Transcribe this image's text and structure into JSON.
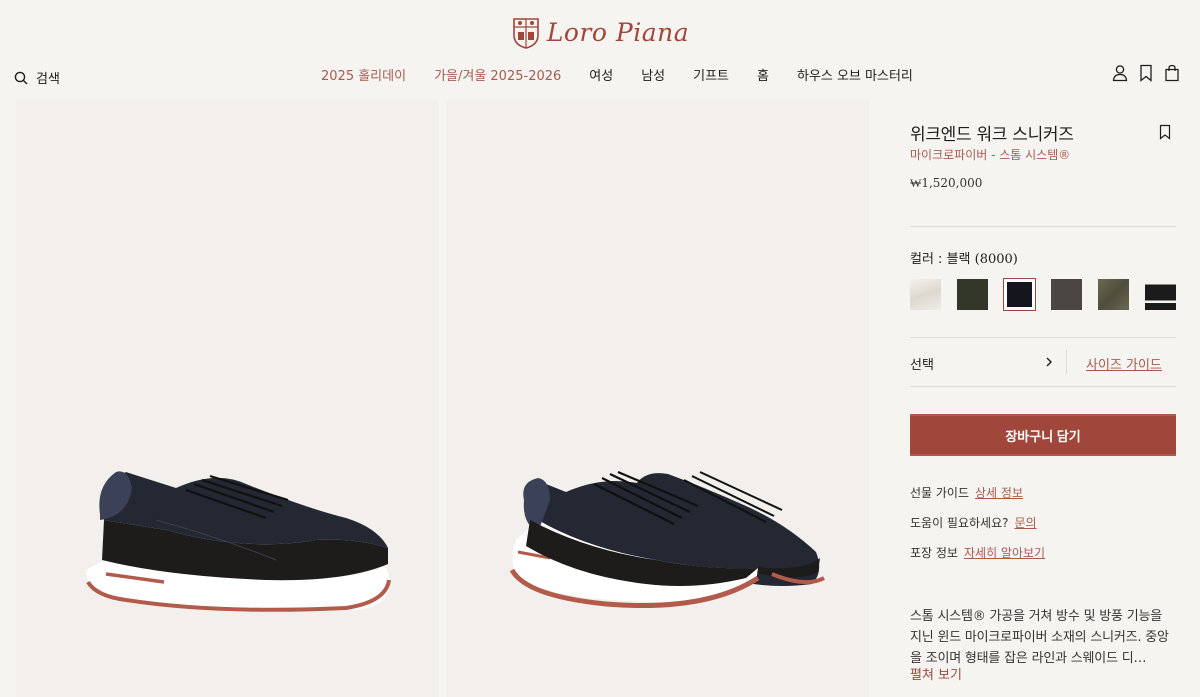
{
  "brand": {
    "name": "Loro Piana"
  },
  "header": {
    "search_label": "검색",
    "nav": [
      {
        "label": "2025 홀리데이",
        "accent": true
      },
      {
        "label": "가을/겨울 2025-2026",
        "accent": true
      },
      {
        "label": "여성",
        "accent": false
      },
      {
        "label": "남성",
        "accent": false
      },
      {
        "label": "기프트",
        "accent": false
      },
      {
        "label": "홈",
        "accent": false
      },
      {
        "label": "하우스 오브 마스터리",
        "accent": false
      }
    ]
  },
  "product": {
    "title": "위크엔드 워크 스니커즈",
    "subtitle": "마이크로파이버 - 스톰 시스템®",
    "price": "₩1,520,000",
    "color_label": "컬러 : 블랙",
    "color_code": "(8000)",
    "swatches": [
      {
        "name": "white",
        "color": "#ebe8e1",
        "selected": false
      },
      {
        "name": "dark-green",
        "color": "#32372a",
        "selected": false
      },
      {
        "name": "black",
        "color": "#15161d",
        "selected": true
      },
      {
        "name": "brown-grey",
        "color": "#4b4544",
        "selected": false
      },
      {
        "name": "olive",
        "color": "#5f5c48",
        "selected": false
      },
      {
        "name": "black-white",
        "color": "#1b1b1b",
        "selected": false
      }
    ],
    "select_label": "선택",
    "size_guide": "사이즈 가이드",
    "cart_button": "장바구니 담기",
    "gift_guide_label": "선물 가이드",
    "gift_guide_link": "상세 정보",
    "help_label": "도움이 필요하세요?",
    "help_link": "문의",
    "packaging_label": "포장 정보",
    "packaging_link": "자세히 알아보기",
    "description": "스톰 시스템® 가공을 거쳐 방수 및 방풍 기능을 지닌 윈드 마이크로파이버 소재의 스니커즈. 중앙을 조이며 형태를 잡은 라인과 스웨이드 디…",
    "read_more": "펼쳐 보기"
  },
  "colors": {
    "accent": "#a0463a",
    "accent_text": "#a65b4e",
    "background": "#f6f4f1"
  }
}
